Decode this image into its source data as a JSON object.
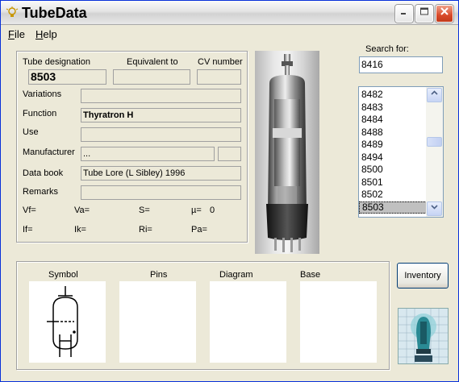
{
  "app": {
    "title": "TubeData",
    "icon": "lightbulb-icon"
  },
  "titlebar_buttons": {
    "minimize": "minimize-icon",
    "maximize": "maximize-icon",
    "close": "close-icon"
  },
  "menu": {
    "file": "File",
    "help": "Help"
  },
  "details": {
    "tube_designation_label": "Tube designation",
    "equivalent_label": "Equivalent to",
    "cv_label": "CV number",
    "tube_designation": "8503",
    "equivalent": "",
    "cv_number": "",
    "variations_label": "Variations",
    "variations": "",
    "function_label": "Function",
    "function": "Thyratron H",
    "use_label": "Use",
    "use": "",
    "manufacturer_label": "Manufacturer",
    "manufacturer": "...",
    "manufacturer_code": "",
    "databook_label": "Data book",
    "databook": "Tube Lore (L Sibley) 1996",
    "remarks_label": "Remarks",
    "remarks": ""
  },
  "params": {
    "vf": "Vf=",
    "va": "Va=",
    "s": "S=",
    "mu": "µ=",
    "mu_value": "0",
    "if": "If=",
    "ik": "Ik=",
    "ri": "Ri=",
    "pa": "Pa="
  },
  "search": {
    "label": "Search for:",
    "value": "8416"
  },
  "tube_list": {
    "items": [
      "8482",
      "8483",
      "8484",
      "8488",
      "8489",
      "8494",
      "8500",
      "8501",
      "8502",
      "8503"
    ],
    "selected": "8503"
  },
  "bottom": {
    "symbol_label": "Symbol",
    "pins_label": "Pins",
    "diagram_label": "Diagram",
    "base_label": "Base"
  },
  "inventory_button": "Inventory",
  "colors": {
    "window_bg": "#ece9d8",
    "selection": "#c0c0c0",
    "input_border": "#7f9db9",
    "close_red": "#d84a2a"
  }
}
